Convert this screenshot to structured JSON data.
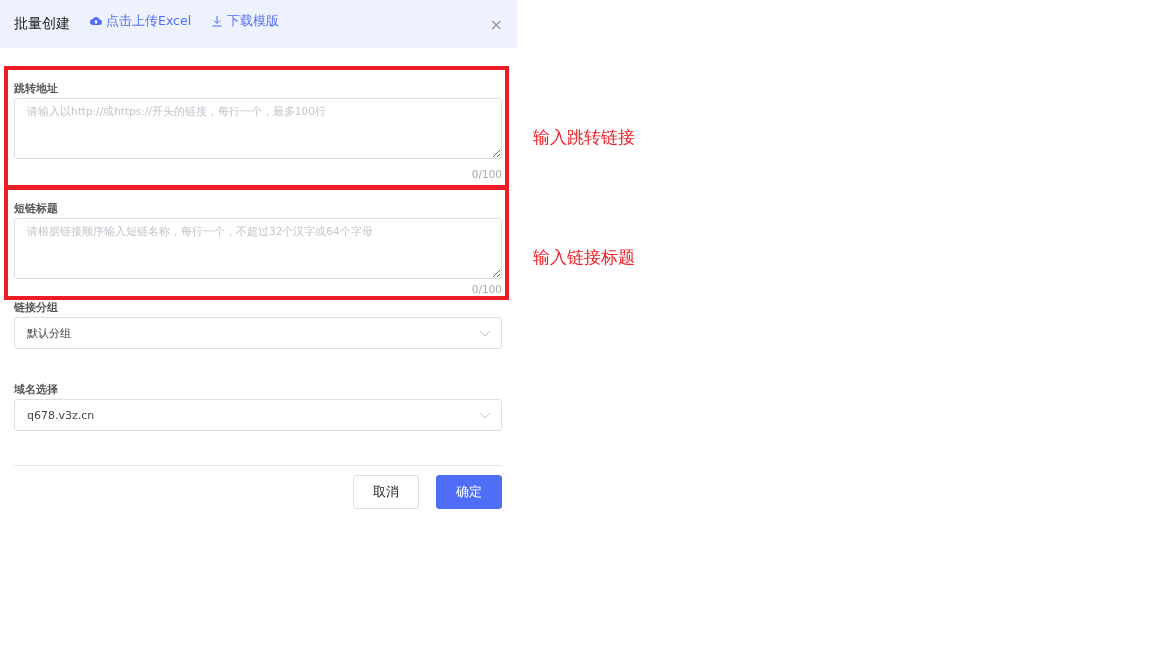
{
  "header": {
    "title": "批量创建",
    "upload_link": "点击上传Excel",
    "download_link": "下载模版",
    "close": "×"
  },
  "fields": [
    {
      "kind": "textarea",
      "label": "跳转地址",
      "placeholder": "请输入以http://或https://开头的链接，每行一个，最多100行",
      "counter": "0/100",
      "annotation": "输入跳转链接"
    },
    {
      "kind": "textarea",
      "label": "短链标题",
      "placeholder": "请根据链接顺序输入短链名称，每行一个，不超过32个汉字或64个字母",
      "counter": "0/100",
      "annotation": "输入链接标题"
    },
    {
      "kind": "select",
      "label": "链接分组",
      "value": "默认分组"
    },
    {
      "kind": "select",
      "label": "域名选择",
      "value": "q678.v3z.cn"
    }
  ],
  "buttons": [
    {
      "label": "取消",
      "primary": false
    },
    {
      "label": "确定",
      "primary": true
    }
  ]
}
